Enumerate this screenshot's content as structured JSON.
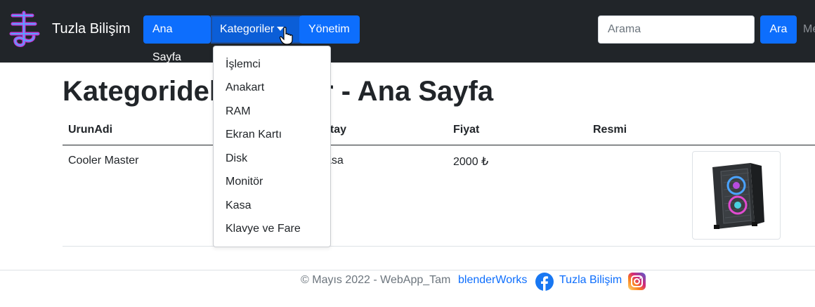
{
  "navbar": {
    "brand": "Tuzla Bilişim",
    "items": [
      {
        "label": "Ana Sayfa"
      },
      {
        "label": "Kategoriler"
      },
      {
        "label": "Yönetim"
      }
    ],
    "search": {
      "placeholder": "Arama",
      "button_label": "Ara"
    },
    "overflow_text": "Me"
  },
  "dropdown": {
    "items": [
      "İşlemci",
      "Anakart",
      "RAM",
      "Ekran Kartı",
      "Disk",
      "Monitör",
      "Kasa",
      "Klavye ve Fare"
    ]
  },
  "main": {
    "title": "Kategoridel... - Ana Sayfa",
    "title_left": "Kategoridel",
    "title_right": "r - Ana Sayfa",
    "table": {
      "headers": [
        "UrunAdi",
        "etay",
        "Fiyat",
        "Resmi"
      ],
      "rows": [
        {
          "name": "Cooler Master",
          "detail": "asa",
          "price": "2000 ₺",
          "image": "pc-case-image"
        }
      ]
    }
  },
  "footer": {
    "text": "© Mayıs 2022 - WebApp_Tam",
    "link1": "blenderWorks",
    "link2": "Tuzla Bilişim"
  },
  "colors": {
    "navbar_bg": "#212529",
    "primary": "#0d6efd",
    "link": "#0d6efd",
    "muted": "#6c757d"
  }
}
